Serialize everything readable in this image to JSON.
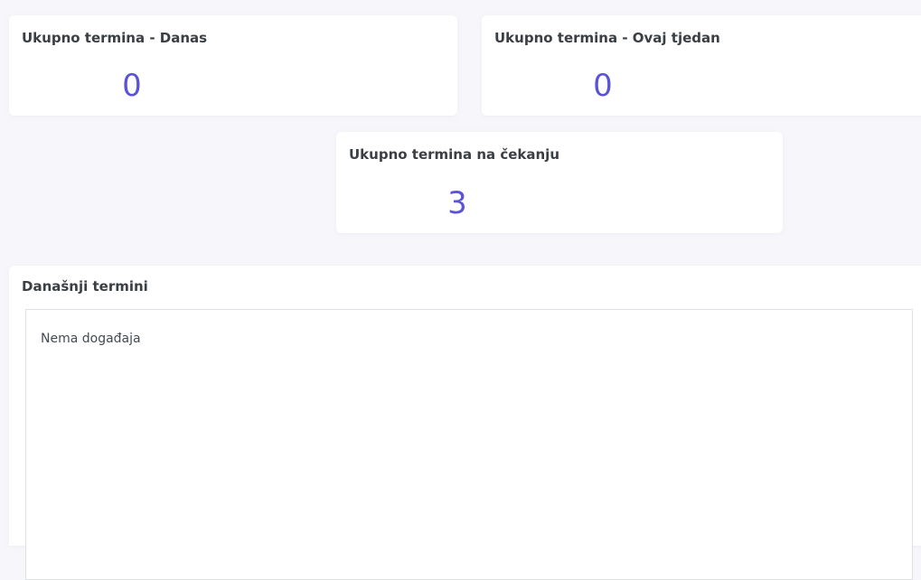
{
  "stats": {
    "today": {
      "label": "Ukupno termina - Danas",
      "value": "0"
    },
    "week": {
      "label": "Ukupno termina - Ovaj tjedan",
      "value": "0"
    },
    "pending": {
      "label": "Ukupno termina na čekanju",
      "value": "3"
    }
  },
  "events": {
    "title": "Današnji termini",
    "empty_text": "Nema događaja"
  },
  "colors": {
    "accent": "#5a53d6",
    "background": "#f7f7fb",
    "card": "#ffffff",
    "border": "#dee2e6"
  }
}
